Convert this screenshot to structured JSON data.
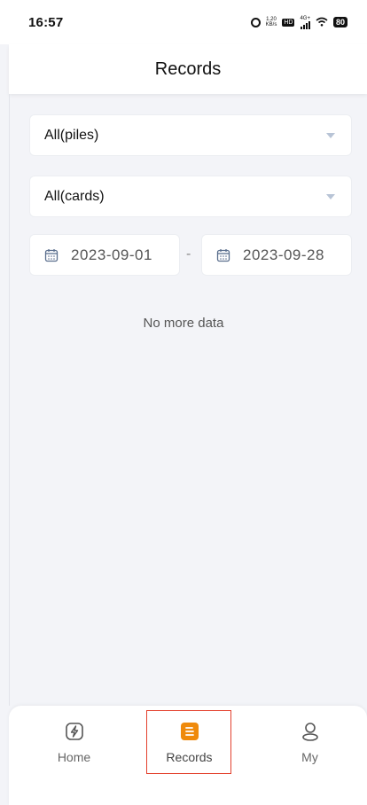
{
  "status_bar": {
    "time": "16:57",
    "speed_top": "1.20",
    "speed_bottom": "KB/s",
    "hd": "HD",
    "network": "4G+",
    "battery": "80"
  },
  "header": {
    "title": "Records"
  },
  "filters": {
    "pile_select": "All(piles)",
    "card_select": "All(cards)",
    "start_date": "2023-09-01",
    "date_separator": "-",
    "end_date": "2023-09-28"
  },
  "list": {
    "empty_text": "No more data"
  },
  "tabbar": {
    "tabs": [
      {
        "label": "Home",
        "icon": "charge-icon"
      },
      {
        "label": "Records",
        "icon": "records-icon"
      },
      {
        "label": "My",
        "icon": "user-icon"
      }
    ]
  },
  "colors": {
    "accent": "#ef8a0c",
    "highlight": "#e3412e"
  }
}
